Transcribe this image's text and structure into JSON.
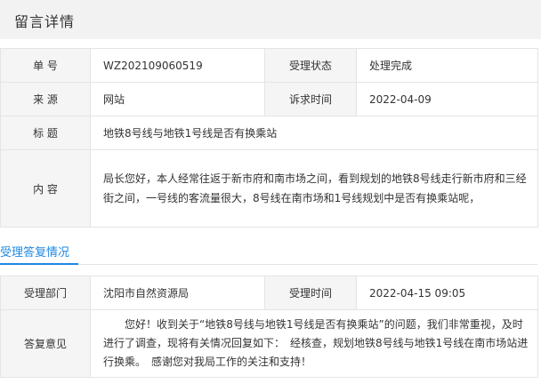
{
  "header": {
    "title": "留言详情"
  },
  "info": {
    "number_label": "单 号",
    "number_value": "WZ202109060519",
    "status_label": "受理状态",
    "status_value": "处理完成",
    "source_label": "来 源",
    "source_value": "网站",
    "request_time_label": "诉求时间",
    "request_time_value": "2022-04-09",
    "title_label": "标 题",
    "title_value": "地铁8号线与地铁1号线是否有换乘站",
    "content_label": "内 容",
    "content_value": "局长您好，本人经常往返于新市府和南市场之间，看到规划的地铁8号线走行新市府和三经街之间，一号线的客流量很大，8号线在南市场和1号线规划中是否有换乘站呢，"
  },
  "reply_section": {
    "title": "受理答复情况"
  },
  "reply": {
    "dept_label": "受理部门",
    "dept_value": "沈阳市自然资源局",
    "time_label": "受理时间",
    "time_value": "2022-04-15 09:05",
    "opinion_label": "答复意见",
    "opinion_value": "您好！收到关于“地铁8号线与地铁1号线是否有换乘站”的问题，我们非常重视，及时进行了调查，现将有关情况回复如下：　经核查，规划地铁8号线与地铁1号线在南市场站进行换乘。　感谢您对我局工作的关注和支持！"
  },
  "colors": {
    "accent": "#1e88e5",
    "reply_text": "#e8641e",
    "label_bg": "#f5f5f5",
    "header_bg": "#f2f2f2"
  }
}
